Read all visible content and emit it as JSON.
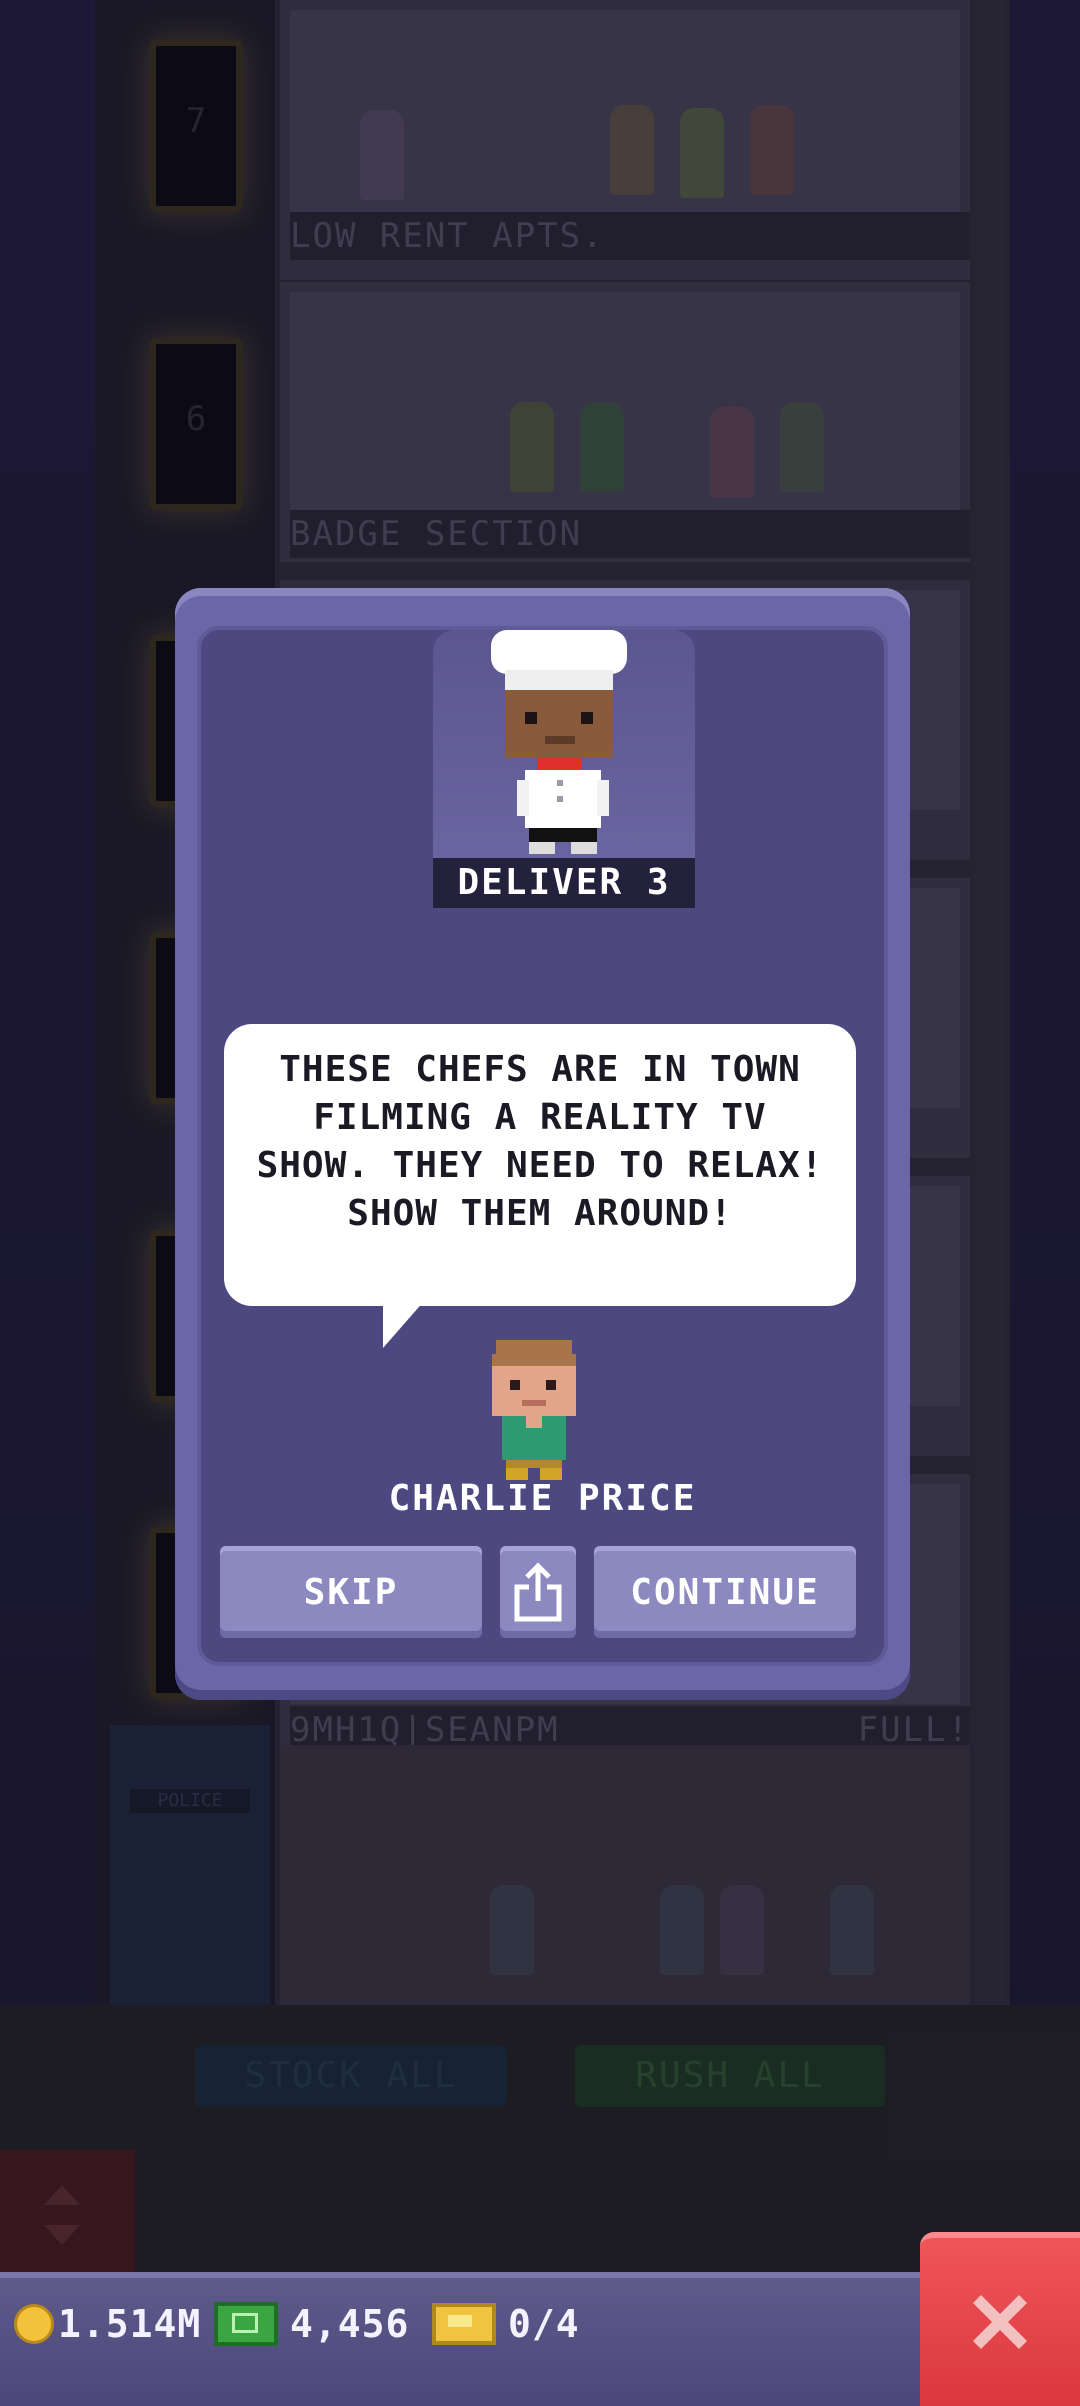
{
  "background": {
    "elevator_floors": [
      "7",
      "6"
    ],
    "floor_labels": [
      "LOW RENT APTS.",
      "BADGE SECTION",
      "9MH1Q|SEANPM"
    ],
    "lobby_status": "FULL!",
    "stock_all_label": "STOCK ALL",
    "rush_all_label": "RUSH ALL",
    "police_sign": "POLICE"
  },
  "modal": {
    "mission_label": "DELIVER 3",
    "message": "THESE CHEFS ARE IN TOWN FILMING A REALITY TV SHOW. THEY NEED TO RELAX! SHOW THEM AROUND!",
    "npc_name": "CHARLIE PRICE",
    "skip_label": "SKIP",
    "share_icon": "share-icon",
    "continue_label": "CONTINUE"
  },
  "status_bar": {
    "coins": "1.514M",
    "bux": "4,456",
    "tickets": "0/4",
    "close_icon": "close-icon"
  },
  "colors": {
    "modal_bg": "#4d4980",
    "modal_frame": "#6b66a6",
    "button": "#8c88c0",
    "close_button": "#e0454a",
    "coin": "#f2c23a",
    "cash": "#3aa541",
    "ticket": "#f0c440"
  }
}
